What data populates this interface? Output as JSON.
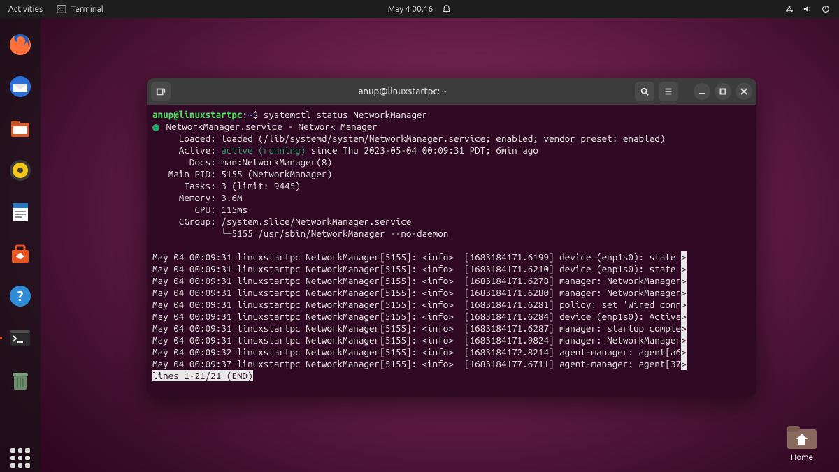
{
  "top_bar": {
    "activities": "Activities",
    "terminal_label": "Terminal",
    "datetime": "May 4  00:16"
  },
  "dock": {
    "items": [
      {
        "name": "firefox-icon"
      },
      {
        "name": "thunderbird-icon"
      },
      {
        "name": "files-icon"
      },
      {
        "name": "rhythmbox-icon"
      },
      {
        "name": "writer-icon"
      },
      {
        "name": "software-icon"
      },
      {
        "name": "help-icon"
      },
      {
        "name": "terminal-icon"
      },
      {
        "name": "trash-icon"
      }
    ]
  },
  "desktop": {
    "home_label": "Home"
  },
  "terminal": {
    "title": "anup@linuxstartpc: ~",
    "prompt_user_host": "anup@linuxstartpc",
    "prompt_sep": ":",
    "prompt_path": "~",
    "prompt_symbol": "$",
    "command": "systemctl status NetworkManager",
    "status": {
      "service_line": "NetworkManager.service - Network Manager",
      "loaded_label": "Loaded:",
      "loaded_value": "loaded (/lib/systemd/system/NetworkManager.service; enabled; vendor preset: enabled)",
      "active_label": "Active:",
      "active_status": "active (running)",
      "active_since": " since Thu 2023-05-04 00:09:31 PDT; 6min ago",
      "docs_label": "Docs:",
      "docs_value": "man:NetworkManager(8)",
      "main_pid_label": "Main PID:",
      "main_pid_value": "5155 (NetworkManager)",
      "tasks_label": "Tasks:",
      "tasks_value": "3 (limit: 9445)",
      "memory_label": "Memory:",
      "memory_value": "3.6M",
      "cpu_label": "CPU:",
      "cpu_value": "115ms",
      "cgroup_label": "CGroup:",
      "cgroup_value": "/system.slice/NetworkManager.service",
      "cgroup_sub": "└─5155 /usr/sbin/NetworkManager --no-daemon"
    },
    "logs": [
      {
        "ts": "May 04 00:09:31",
        "host": "linuxstartpc",
        "proc": "NetworkManager[5155]:",
        "lvl": "<info>",
        "bracket": "[1683184171.6199]",
        "msg": "device (enp1s0): state "
      },
      {
        "ts": "May 04 00:09:31",
        "host": "linuxstartpc",
        "proc": "NetworkManager[5155]:",
        "lvl": "<info>",
        "bracket": "[1683184171.6210]",
        "msg": "device (enp1s0): state "
      },
      {
        "ts": "May 04 00:09:31",
        "host": "linuxstartpc",
        "proc": "NetworkManager[5155]:",
        "lvl": "<info>",
        "bracket": "[1683184171.6278]",
        "msg": "manager: NetworkManager"
      },
      {
        "ts": "May 04 00:09:31",
        "host": "linuxstartpc",
        "proc": "NetworkManager[5155]:",
        "lvl": "<info>",
        "bracket": "[1683184171.6280]",
        "msg": "manager: NetworkManager"
      },
      {
        "ts": "May 04 00:09:31",
        "host": "linuxstartpc",
        "proc": "NetworkManager[5155]:",
        "lvl": "<info>",
        "bracket": "[1683184171.6281]",
        "msg": "policy: set 'Wired conn"
      },
      {
        "ts": "May 04 00:09:31",
        "host": "linuxstartpc",
        "proc": "NetworkManager[5155]:",
        "lvl": "<info>",
        "bracket": "[1683184171.6284]",
        "msg": "device (enp1s0): Activa"
      },
      {
        "ts": "May 04 00:09:31",
        "host": "linuxstartpc",
        "proc": "NetworkManager[5155]:",
        "lvl": "<info>",
        "bracket": "[1683184171.6287]",
        "msg": "manager: startup comple"
      },
      {
        "ts": "May 04 00:09:31",
        "host": "linuxstartpc",
        "proc": "NetworkManager[5155]:",
        "lvl": "<info>",
        "bracket": "[1683184171.9824]",
        "msg": "manager: NetworkManager"
      },
      {
        "ts": "May 04 00:09:32",
        "host": "linuxstartpc",
        "proc": "NetworkManager[5155]:",
        "lvl": "<info>",
        "bracket": "[1683184172.8214]",
        "msg": "agent-manager: agent[a6"
      },
      {
        "ts": "May 04 00:09:37",
        "host": "linuxstartpc",
        "proc": "NetworkManager[5155]:",
        "lvl": "<info>",
        "bracket": "[1683184177.6711]",
        "msg": "agent-manager: agent[37"
      }
    ],
    "pager": "lines 1-21/21 (END)"
  }
}
